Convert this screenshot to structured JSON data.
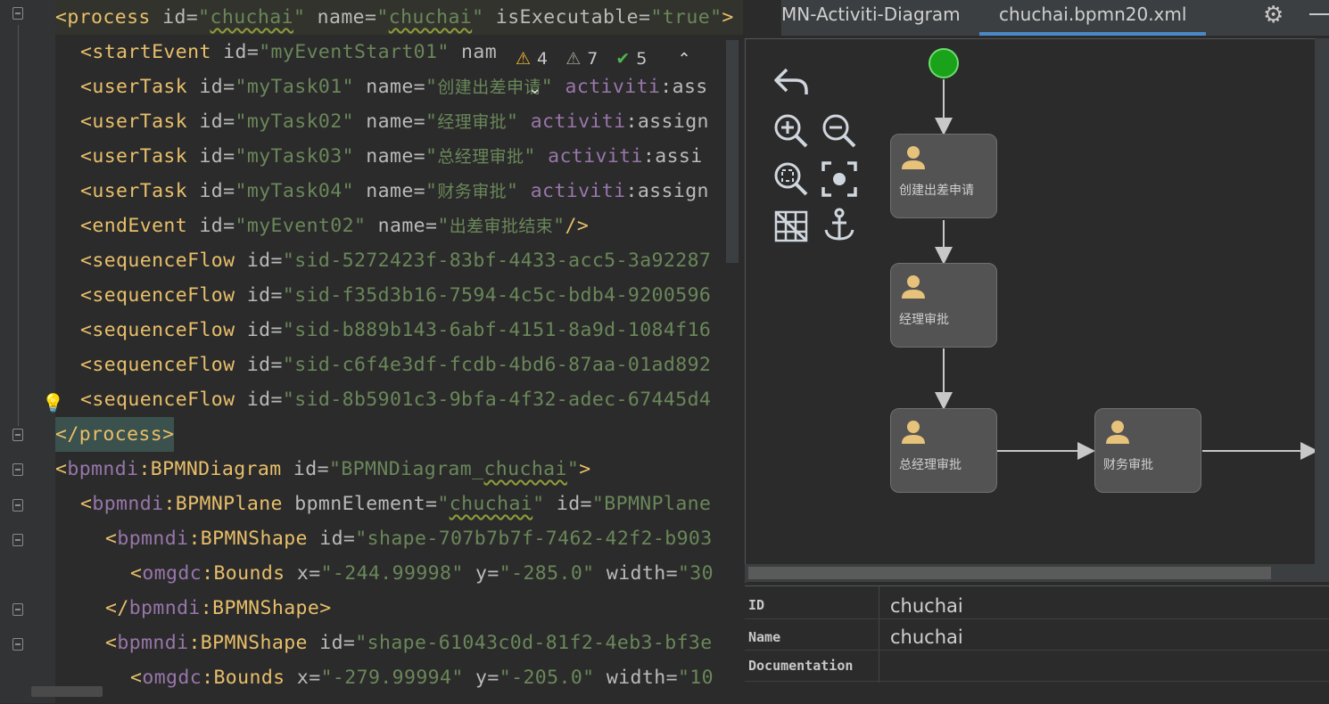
{
  "editor": {
    "lines": [
      {
        "parts": [
          [
            "tag",
            "<process "
          ],
          [
            "attr",
            "id="
          ],
          [
            "val",
            "\""
          ],
          [
            "valw",
            "chuchai"
          ],
          [
            "val",
            "\" "
          ],
          [
            "attr",
            "name="
          ],
          [
            "val",
            "\""
          ],
          [
            "valw",
            "chuchai"
          ],
          [
            "val",
            "\" "
          ],
          [
            "attr",
            "isExecutable="
          ],
          [
            "val",
            "\"true\""
          ],
          [
            "tag",
            ">"
          ]
        ]
      },
      {
        "parts": [
          [
            "tag",
            "<startEvent "
          ],
          [
            "attr",
            "id="
          ],
          [
            "val",
            "\"myEventStart01\" "
          ],
          [
            "attr",
            "nam"
          ]
        ]
      },
      {
        "parts": [
          [
            "tag",
            "<userTask "
          ],
          [
            "attr",
            "id="
          ],
          [
            "val",
            "\"myTask01\" "
          ],
          [
            "attr",
            "name="
          ],
          [
            "val",
            "\""
          ],
          [
            "cn",
            "创建出差申请"
          ],
          [
            "val",
            "\" "
          ],
          [
            "ns",
            "activiti"
          ],
          [
            "attr",
            ":ass"
          ]
        ]
      },
      {
        "parts": [
          [
            "tag",
            "<userTask "
          ],
          [
            "attr",
            "id="
          ],
          [
            "val",
            "\"myTask02\" "
          ],
          [
            "attr",
            "name="
          ],
          [
            "val",
            "\""
          ],
          [
            "cn",
            "经理审批"
          ],
          [
            "val",
            "\" "
          ],
          [
            "ns",
            "activiti"
          ],
          [
            "attr",
            ":assign"
          ]
        ]
      },
      {
        "parts": [
          [
            "tag",
            "<userTask "
          ],
          [
            "attr",
            "id="
          ],
          [
            "val",
            "\"myTask03\" "
          ],
          [
            "attr",
            "name="
          ],
          [
            "val",
            "\""
          ],
          [
            "cn",
            "总经理审批"
          ],
          [
            "val",
            "\" "
          ],
          [
            "ns",
            "activiti"
          ],
          [
            "attr",
            ":assi"
          ]
        ]
      },
      {
        "parts": [
          [
            "tag",
            "<userTask "
          ],
          [
            "attr",
            "id="
          ],
          [
            "val",
            "\"myTask04\" "
          ],
          [
            "attr",
            "name="
          ],
          [
            "val",
            "\""
          ],
          [
            "cn",
            "财务审批"
          ],
          [
            "val",
            "\" "
          ],
          [
            "ns",
            "activiti"
          ],
          [
            "attr",
            ":assign"
          ]
        ]
      },
      {
        "parts": [
          [
            "tag",
            "<endEvent "
          ],
          [
            "attr",
            "id="
          ],
          [
            "val",
            "\"myEvent02\" "
          ],
          [
            "attr",
            "name="
          ],
          [
            "val",
            "\""
          ],
          [
            "cn",
            "出差审批结束"
          ],
          [
            "val",
            "\""
          ],
          [
            "tag",
            "/>"
          ]
        ]
      },
      {
        "parts": [
          [
            "tag",
            "<sequenceFlow "
          ],
          [
            "attr",
            "id="
          ],
          [
            "val",
            "\"sid-5272423f-83bf-4433-acc5-3a92287"
          ]
        ]
      },
      {
        "parts": [
          [
            "tag",
            "<sequenceFlow "
          ],
          [
            "attr",
            "id="
          ],
          [
            "val",
            "\"sid-f35d3b16-7594-4c5c-bdb4-9200596"
          ]
        ]
      },
      {
        "parts": [
          [
            "tag",
            "<sequenceFlow "
          ],
          [
            "attr",
            "id="
          ],
          [
            "val",
            "\"sid-b889b143-6abf-4151-8a9d-1084f16"
          ]
        ]
      },
      {
        "parts": [
          [
            "tag",
            "<sequenceFlow "
          ],
          [
            "attr",
            "id="
          ],
          [
            "val",
            "\"sid-c6f4e3df-fcdb-4bd6-87aa-01ad892"
          ]
        ]
      },
      {
        "parts": [
          [
            "tag",
            "<sequenceFlow "
          ],
          [
            "attr",
            "id="
          ],
          [
            "val",
            "\"sid-8b5901c3-9bfa-4f32-adec-67445d4"
          ]
        ]
      },
      {
        "parts": [
          [
            "tag",
            "</process>"
          ]
        ]
      },
      {
        "parts": [
          [
            "tag",
            "<"
          ],
          [
            "ns",
            "bpmndi"
          ],
          [
            "tag",
            ":BPMNDiagram "
          ],
          [
            "attr",
            "id="
          ],
          [
            "val",
            "\"BPMNDiagram_"
          ],
          [
            "valw",
            "chuchai"
          ],
          [
            "val",
            "\""
          ],
          [
            "tag",
            ">"
          ]
        ]
      },
      {
        "parts": [
          [
            "tag",
            "<"
          ],
          [
            "ns",
            "bpmndi"
          ],
          [
            "tag",
            ":BPMNPlane "
          ],
          [
            "attr",
            "bpmnElement="
          ],
          [
            "val",
            "\""
          ],
          [
            "valw",
            "chuchai"
          ],
          [
            "val",
            "\" "
          ],
          [
            "attr",
            "id="
          ],
          [
            "val",
            "\"BPMNPlane"
          ]
        ]
      },
      {
        "parts": [
          [
            "tag",
            "<"
          ],
          [
            "ns",
            "bpmndi"
          ],
          [
            "tag",
            ":BPMNShape "
          ],
          [
            "attr",
            "id="
          ],
          [
            "val",
            "\"shape-707b7b7f-7462-42f2-b903"
          ]
        ]
      },
      {
        "parts": [
          [
            "tag",
            "<"
          ],
          [
            "ns",
            "omgdc"
          ],
          [
            "tag",
            ":Bounds "
          ],
          [
            "attr",
            "x="
          ],
          [
            "val",
            "\"-244.99998\" "
          ],
          [
            "attr",
            "y="
          ],
          [
            "val",
            "\"-285.0\" "
          ],
          [
            "attr",
            "width="
          ],
          [
            "val",
            "\"30"
          ]
        ]
      },
      {
        "parts": [
          [
            "tag",
            "</"
          ],
          [
            "ns",
            "bpmndi"
          ],
          [
            "tag",
            ":BPMNShape>"
          ]
        ]
      },
      {
        "parts": [
          [
            "tag",
            "<"
          ],
          [
            "ns",
            "bpmndi"
          ],
          [
            "tag",
            ":BPMNShape "
          ],
          [
            "attr",
            "id="
          ],
          [
            "val",
            "\"shape-61043c0d-81f2-4eb3-bf3e"
          ]
        ]
      },
      {
        "parts": [
          [
            "tag",
            "<"
          ],
          [
            "ns",
            "omgdc"
          ],
          [
            "tag",
            ":Bounds "
          ],
          [
            "attr",
            "x="
          ],
          [
            "val",
            "\"-279.99994\" "
          ],
          [
            "attr",
            "y="
          ],
          [
            "val",
            "\"-205.0\" "
          ],
          [
            "attr",
            "width="
          ],
          [
            "val",
            "\"10"
          ]
        ]
      }
    ],
    "inspections": {
      "warnings": "4",
      "weak_warnings": "7",
      "typos": "5"
    }
  },
  "tabs": {
    "tab1": "MN-Activiti-Diagram",
    "tab2": "chuchai.bpmn20.xml"
  },
  "diagram": {
    "tasks": {
      "t1": "创建出差申请",
      "t2": "经理审批",
      "t3": "总经理审批",
      "t4": "财务审批"
    },
    "colors": {
      "start_event": "#1aa31a",
      "task_fill": "#535353",
      "user_icon": "#e6c27a"
    }
  },
  "properties": {
    "id_label": "ID",
    "id_value": "chuchai",
    "name_label": "Name",
    "name_value": "chuchai",
    "doc_label": "Documentation",
    "doc_value": ""
  }
}
